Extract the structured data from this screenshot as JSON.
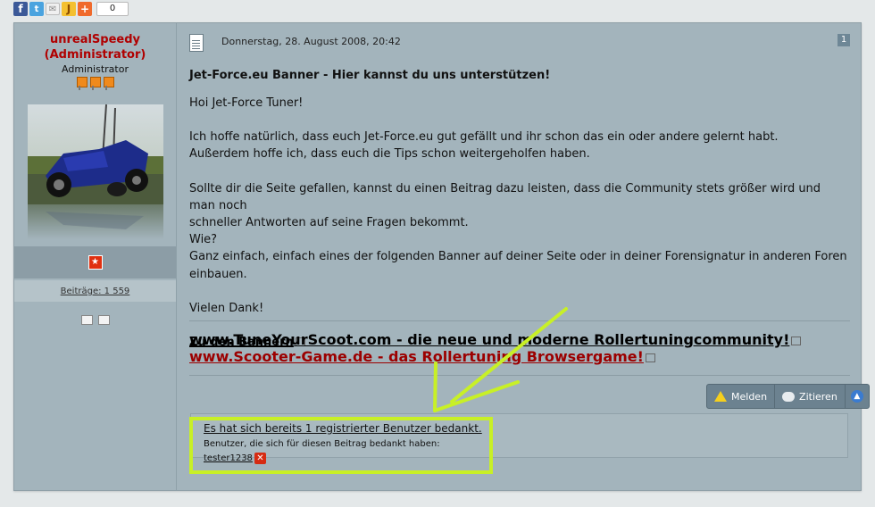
{
  "share": {
    "icons": [
      "facebook-icon",
      "twitter-icon",
      "mail-icon",
      "bookmark-icon",
      "plus-icon"
    ],
    "count": "0"
  },
  "author": {
    "name": "unrealSpeedy",
    "role_paren": "(Administrator)",
    "rank_title": "Administrator",
    "posts_label": "Beiträge: 1 559"
  },
  "post": {
    "date": "Donnerstag, 28. August 2008, 20:42",
    "number": "1",
    "title": "Jet-Force.eu Banner - Hier kannst du uns unterstützen!",
    "greeting": "Hoi Jet-Force Tuner!",
    "p1_line1": "Ich hoffe natürlich, dass euch Jet-Force.eu gut gefällt und ihr schon das ein oder andere gelernt habt.",
    "p1_line2": "Außerdem hoffe ich, dass euch die Tips schon weitergeholfen haben.",
    "p2_line1": "Sollte dir die Seite gefallen, kannst du einen Beitrag dazu leisten, dass die Community stets größer wird und man noch",
    "p2_line2": "schneller Antworten auf seine Fragen bekommt.",
    "p2_line3": "Wie?",
    "p2_line4": "Ganz einfach, einfach eines der folgenden Banner auf deiner Seite oder in deiner Forensignatur in anderen Foren einbauen.",
    "thanks_line": "Vielen Dank!",
    "banner_link": "Zu den Bannern"
  },
  "signature": {
    "link1": "www.TuneYourScoot.com - die neue und moderne Rollertuningcommunity!",
    "link2": "www.Scooter-Game.de - das Rollertuning Browsergame!"
  },
  "actions": {
    "report": "Melden",
    "quote": "Zitieren"
  },
  "thanks": {
    "title": "Es hat sich bereits 1 registrierter Benutzer bedankt.",
    "subtitle": "Benutzer, die sich für diesen Beitrag bedankt haben:",
    "user": "tester1238"
  },
  "colors": {
    "highlight": "#c8f026",
    "username": "#b00000",
    "link_red": "#9c0000"
  }
}
